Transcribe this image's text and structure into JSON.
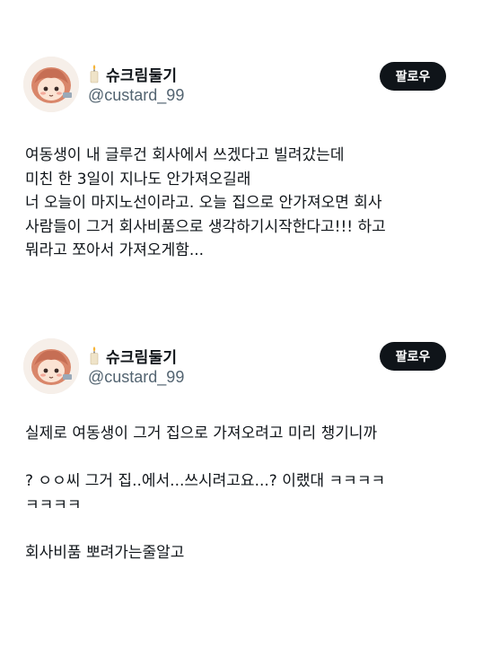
{
  "tweets": [
    {
      "user": {
        "display_name": "슈크림둘기",
        "handle": "@custard_99",
        "avatar_icon": "avatar-illustration",
        "name_emoji_icon": "candle-icon"
      },
      "follow_label": "팔로우",
      "lines": [
        "여동생이 내 글루건 회사에서 쓰겠다고 빌려갔는데",
        "미친 한 3일이 지나도 안가져오길래",
        "너 오늘이 마지노선이라고. 오늘 집으로 안가져오면 회사",
        "사람들이 그거 회사비품으로 생각하기시작한다고!!! 하고",
        "뭐라고 쪼아서 가져오게함..."
      ]
    },
    {
      "user": {
        "display_name": "슈크림둘기",
        "handle": "@custard_99",
        "avatar_icon": "avatar-illustration",
        "name_emoji_icon": "candle-icon"
      },
      "follow_label": "팔로우",
      "lines": [
        "실제로 여동생이 그거 집으로 가져오려고 미리 챙기니까",
        "",
        "? ㅇㅇ씨 그거 집..에서...쓰시려고요...? 이랬대 ㅋㅋㅋㅋ",
        "ㅋㅋㅋㅋ",
        "",
        "회사비품 뽀려가는줄알고"
      ]
    }
  ],
  "colors": {
    "text_primary": "#0f1419",
    "text_secondary": "#536471",
    "button_bg": "#0f1419",
    "button_text": "#ffffff"
  }
}
